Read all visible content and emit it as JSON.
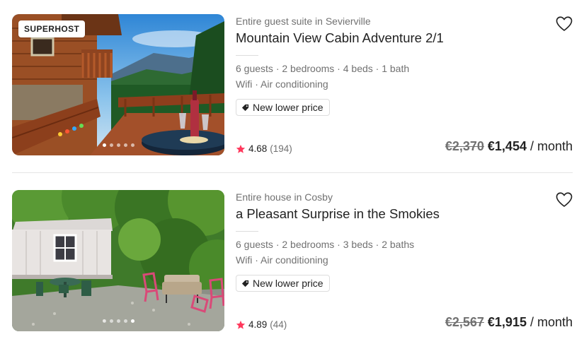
{
  "listings": [
    {
      "badge": "SUPERHOST",
      "subtitle": "Entire guest suite in Sevierville",
      "title": "Mountain View Cabin Adventure 2/1",
      "details": "6 guests · 2 bedrooms · 4 beds · 1 bath",
      "amenities": "Wifi · Air conditioning",
      "tag": "New lower price",
      "rating": "4.68",
      "reviews": "(194)",
      "old_price": "€2,370",
      "new_price": "€1,454",
      "per": "/ month",
      "photo_dots": 5,
      "active_dot": 0,
      "icons": {
        "favorite": "heart-outline-icon",
        "tag": "price-tag-icon",
        "rating": "star-icon"
      }
    },
    {
      "subtitle": "Entire house in Cosby",
      "title": "a Pleasant Surprise in the Smokies",
      "details": "6 guests · 2 bedrooms · 3 beds · 2 baths",
      "amenities": "Wifi · Air conditioning",
      "tag": "New lower price",
      "rating": "4.89",
      "reviews": "(44)",
      "old_price": "€2,567",
      "new_price": "€1,915",
      "per": "/ month",
      "photo_dots": 5,
      "active_dot": 4,
      "icons": {
        "favorite": "heart-outline-icon",
        "tag": "price-tag-icon",
        "rating": "star-icon"
      }
    }
  ],
  "colors": {
    "star": "#FF385C",
    "muted_text": "#717171",
    "primary_text": "#222222",
    "divider": "#EBEBEB"
  }
}
